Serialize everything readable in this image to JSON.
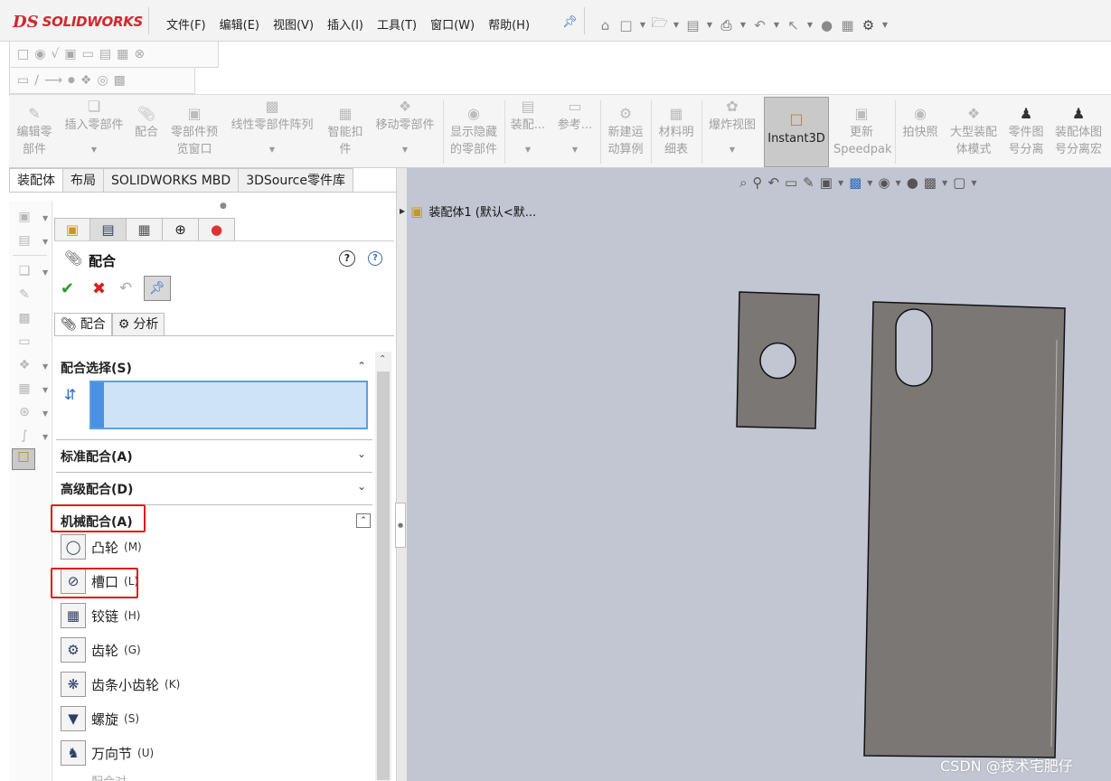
{
  "app": {
    "logo_ds": "DS",
    "logo_word": "SOLIDWORKS"
  },
  "menu": [
    "文件(F)",
    "编辑(E)",
    "视图(V)",
    "插入(I)",
    "工具(T)",
    "窗口(W)",
    "帮助(H)"
  ],
  "commands": {
    "edit_part": [
      "编辑零",
      "部件"
    ],
    "insert_part": "插入零部件",
    "mate": "配合",
    "preview_window": [
      "零部件预",
      "览窗口"
    ],
    "linear_pattern": "线性零部件阵列",
    "smart_fastener": [
      "智能扣",
      "件"
    ],
    "move_part": "移动零部件",
    "show_hidden": [
      "显示隐藏",
      "的零部件"
    ],
    "assembly": "装配...",
    "reference": "参考...",
    "new_motion": [
      "新建运",
      "动算例"
    ],
    "bom": [
      "材料明",
      "细表"
    ],
    "exploded": "爆炸视图",
    "instant3d": "Instant3D",
    "update": [
      "更新",
      "Speedpak"
    ],
    "snapshot": "拍快照",
    "large_assembly": [
      "大型装配",
      "体模式"
    ],
    "part_drawing_split": [
      "零件图",
      "号分离"
    ],
    "assembly_drawing_split": [
      "装配体图",
      "号分离宏"
    ]
  },
  "tabs": [
    "装配体",
    "布局",
    "SOLIDWORKS MBD",
    "3DSource零件库"
  ],
  "property_manager": {
    "title": "配合",
    "help1": "?",
    "help2": "?",
    "subtabs": {
      "mates": "配合",
      "analysis": "分析"
    },
    "sections": {
      "mate_selection": "配合选择(S)",
      "standard": "标准配合(A)",
      "advanced": "高级配合(D)",
      "mechanical": "机械配合(A)"
    },
    "mechanical_items": [
      {
        "label": "凸轮",
        "short": "(M)"
      },
      {
        "label": "槽口",
        "short": "(L)"
      },
      {
        "label": "铰链",
        "short": "(H)"
      },
      {
        "label": "齿轮",
        "short": "(G)"
      },
      {
        "label": "齿条小齿轮",
        "short": "(K)"
      },
      {
        "label": "螺旋",
        "short": "(S)"
      },
      {
        "label": "万向节",
        "short": "(U)"
      }
    ],
    "partial_next": "配合对"
  },
  "graphics": {
    "tree_root": "装配体1 (默认<默..."
  },
  "watermark": "CSDN @技术宅肥仔",
  "colors": {
    "viewport_bg": "#c2c6d2",
    "part_fill": "#7a7775",
    "highlight_red": "#e01818",
    "selection_blue": "#cfe3f7"
  }
}
